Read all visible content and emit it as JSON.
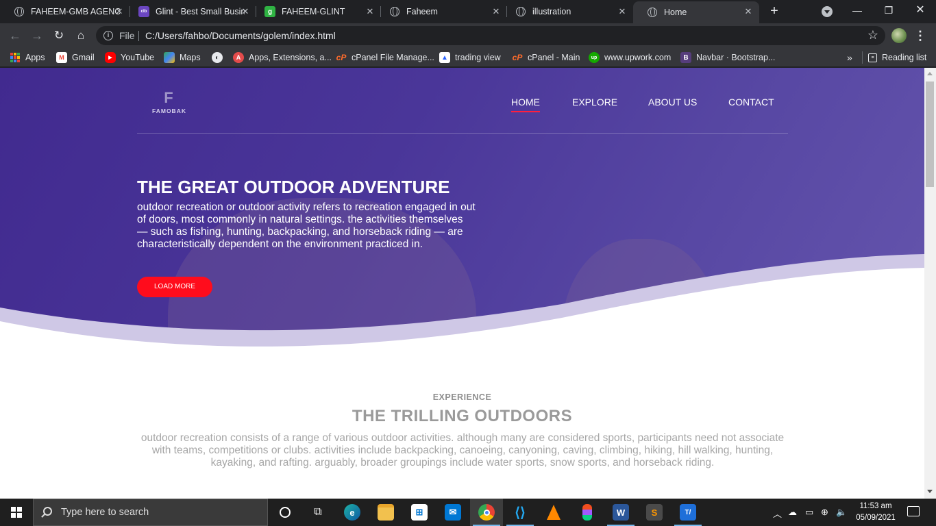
{
  "browser": {
    "tabs": [
      {
        "title": "FAHEEM-GMB AGENCY",
        "icon": "globe-icon",
        "active": false
      },
      {
        "title": "Glint - Best Small Business",
        "icon": "colorlib-icon",
        "active": false
      },
      {
        "title": "FAHEEM-GLINT",
        "icon": "glint-g-icon",
        "active": false
      },
      {
        "title": "Faheem",
        "icon": "globe-icon",
        "active": false
      },
      {
        "title": "illustration",
        "icon": "globe-icon",
        "active": false
      },
      {
        "title": "Home",
        "icon": "globe-icon",
        "active": true
      }
    ],
    "address": {
      "scheme_label": "File",
      "url": "C:/Users/fahbo/Documents/golem/index.html"
    },
    "bookmarks": [
      {
        "label": "Apps",
        "icon": "apps-grid-icon"
      },
      {
        "label": "Gmail",
        "icon": "gmail-icon"
      },
      {
        "label": "YouTube",
        "icon": "youtube-icon"
      },
      {
        "label": "Maps",
        "icon": "maps-icon"
      },
      {
        "label": "",
        "icon": "globe-icon"
      },
      {
        "label": "Apps, Extensions, a...",
        "icon": "extensions-icon"
      },
      {
        "label": "cPanel File Manage...",
        "icon": "cpanel-icon"
      },
      {
        "label": "trading view",
        "icon": "tradingview-icon"
      },
      {
        "label": "cPanel - Main",
        "icon": "cpanel-icon"
      },
      {
        "label": "www.upwork.com",
        "icon": "upwork-icon"
      },
      {
        "label": "Navbar · Bootstrap...",
        "icon": "bootstrap-icon"
      }
    ],
    "reading_list_label": "Reading list",
    "overflow_label": "»"
  },
  "page": {
    "logo": {
      "mark": "F",
      "text": "FAMOBAK"
    },
    "nav": [
      "HOME",
      "EXPLORE",
      "ABOUT US",
      "CONTACT"
    ],
    "hero": {
      "title": "THE GREAT OUTDOOR ADVENTURE",
      "text": "outdoor recreation or outdoor activity refers to recreation engaged in out of doors, most commonly in natural settings. the activities themselves — such as fishing, hunting, backpacking, and horseback riding — are characteristically dependent on the environment practiced in.",
      "button": "LOAD MORE"
    },
    "section": {
      "kicker": "EXPERIENCE",
      "title": "THE TRILLING OUTDOORS",
      "text": "outdoor recreation consists of a range of various outdoor activities. although many are considered sports, participants need not associate with teams, competitions or clubs. activities include backpacking, canoeing, canyoning, caving, climbing, hiking, hill walking, hunting, kayaking, and rafting. arguably, broader groupings include water sports, snow sports, and horseback riding."
    }
  },
  "taskbar": {
    "search_placeholder": "Type here to search",
    "apps": [
      "cortana-icon",
      "task-view-icon",
      "edge-icon",
      "file-explorer-icon",
      "store-icon",
      "mail-icon",
      "chrome-icon",
      "vscode-icon",
      "vlc-icon",
      "figma-icon",
      "word-icon",
      "sublime-icon",
      "typora-icon"
    ],
    "time": "11:53 am",
    "date": "05/09/2021"
  },
  "colors": {
    "hero_start": "#412a8f",
    "hero_end": "#6555ad",
    "accent_red": "#ff0c1c",
    "nav_underline": "#ff1f3d"
  }
}
